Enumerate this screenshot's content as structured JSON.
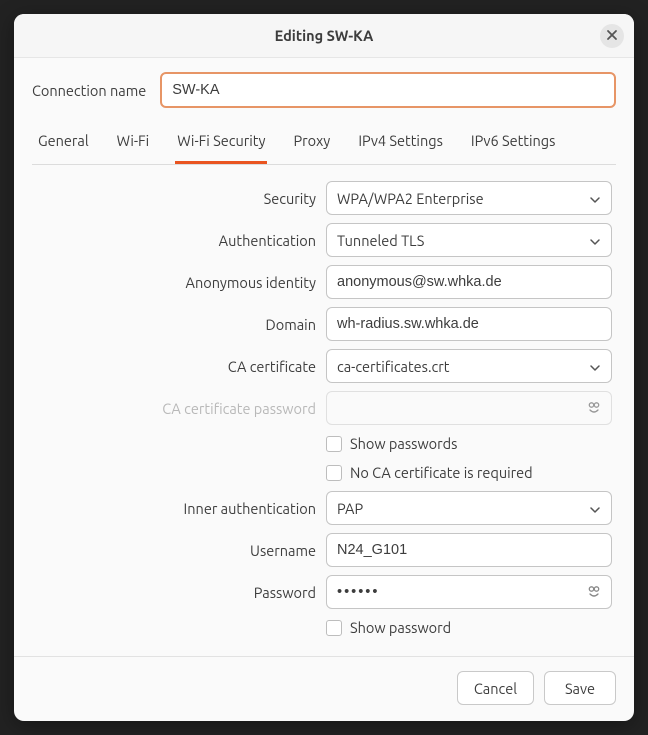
{
  "titlebar": {
    "title": "Editing SW-KA"
  },
  "connection": {
    "label": "Connection name",
    "value": "SW-KA"
  },
  "tabs": {
    "items": [
      {
        "label": "General"
      },
      {
        "label": "Wi-Fi"
      },
      {
        "label": "Wi-Fi Security",
        "active": true
      },
      {
        "label": "Proxy"
      },
      {
        "label": "IPv4 Settings"
      },
      {
        "label": "IPv6 Settings"
      }
    ]
  },
  "fields": {
    "security": {
      "label": "Security",
      "value": "WPA/WPA2 Enterprise",
      "type": "select"
    },
    "authentication": {
      "label": "Authentication",
      "value": "Tunneled TLS",
      "type": "select"
    },
    "anonymous_identity": {
      "label": "Anonymous identity",
      "value": "anonymous@sw.whka.de",
      "type": "text"
    },
    "domain": {
      "label": "Domain",
      "value": "wh-radius.sw.whka.de",
      "type": "text"
    },
    "ca_certificate": {
      "label": "CA certificate",
      "value": "ca-certificates.crt",
      "type": "select"
    },
    "ca_cert_password": {
      "label": "CA certificate password",
      "value": "",
      "type": "password",
      "disabled": true
    },
    "show_passwords": {
      "label": "Show passwords",
      "checked": false
    },
    "no_ca_required": {
      "label": "No CA certificate is required",
      "checked": false
    },
    "inner_authentication": {
      "label": "Inner authentication",
      "value": "PAP",
      "type": "select"
    },
    "username": {
      "label": "Username",
      "value": "N24_G101",
      "type": "text"
    },
    "password": {
      "label": "Password",
      "value": "••••••",
      "type": "password"
    },
    "show_password": {
      "label": "Show password",
      "checked": false
    }
  },
  "footer": {
    "cancel": "Cancel",
    "save": "Save"
  }
}
